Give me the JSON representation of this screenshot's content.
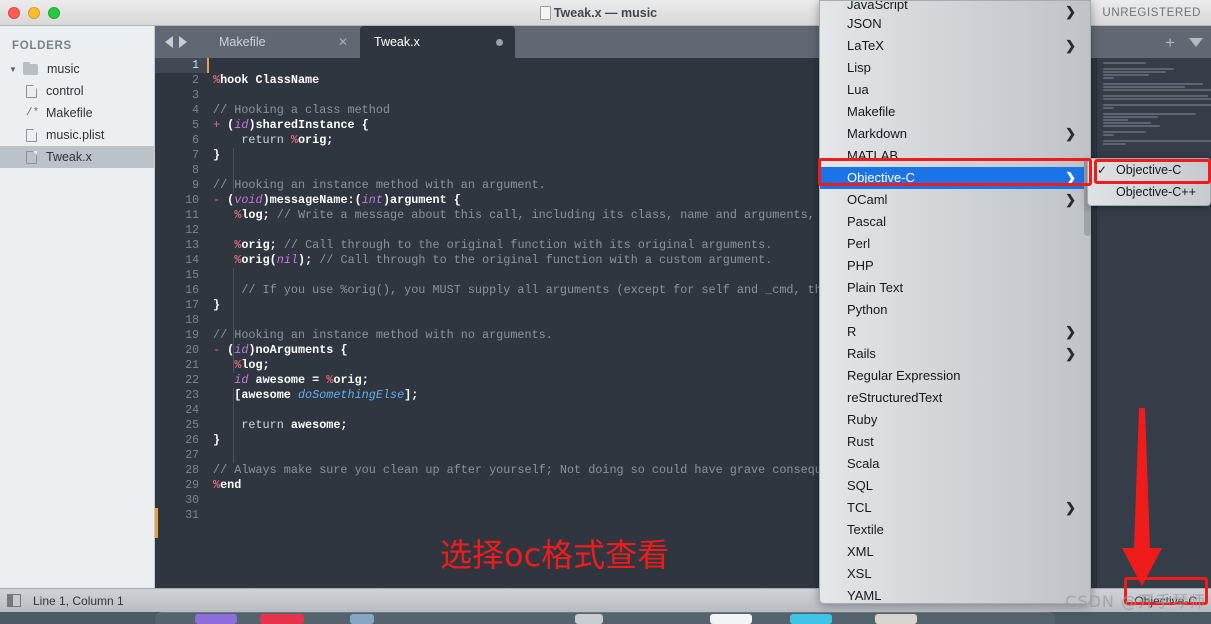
{
  "window": {
    "title": "Tweak.x — music",
    "unregistered_label": "UNREGISTERED",
    "traffic_lights": [
      "close-button",
      "minimize-button",
      "zoom-button"
    ]
  },
  "sidebar": {
    "header": "FOLDERS",
    "root": {
      "label": "music",
      "expanded_glyph": "▼"
    },
    "items": [
      {
        "label": "control",
        "icon": "file-icon",
        "selected": false
      },
      {
        "label": "Makefile",
        "icon": "makefile-icon",
        "selected": false
      },
      {
        "label": "music.plist",
        "icon": "file-icon",
        "selected": false
      },
      {
        "label": "Tweak.x",
        "icon": "file-icon",
        "selected": true
      }
    ]
  },
  "tabbar": {
    "nav_back": "◀",
    "nav_forward": "▶",
    "tabs": [
      {
        "label": "Makefile",
        "active": false,
        "close_glyph": "✕"
      },
      {
        "label": "Tweak.x",
        "active": true,
        "dirty_dot": true
      }
    ],
    "new_tab_glyph": "+",
    "tab_list_glyph": "▼"
  },
  "editor": {
    "annotation_cn": "选择oc格式查看",
    "lines": [
      {
        "n": 1,
        "current": true,
        "tokens": []
      },
      {
        "n": 2,
        "tokens": [
          {
            "t": "%",
            "c": "c-pct"
          },
          {
            "t": "hook ClassName",
            "c": "c-bold"
          }
        ]
      },
      {
        "n": 3,
        "tokens": []
      },
      {
        "n": 4,
        "tokens": [
          {
            "t": "// Hooking a class method",
            "c": "c-cmt"
          }
        ]
      },
      {
        "n": 5,
        "tokens": [
          {
            "t": "+ ",
            "c": "c-key"
          },
          {
            "t": "(",
            "c": "c-bold"
          },
          {
            "t": "id",
            "c": "c-type"
          },
          {
            "t": ")sharedInstance {",
            "c": "c-bold"
          }
        ]
      },
      {
        "n": 6,
        "tokens": [
          {
            "t": "    return ",
            "c": "c-plain"
          },
          {
            "t": "%",
            "c": "c-pct"
          },
          {
            "t": "orig;",
            "c": "c-bold"
          }
        ]
      },
      {
        "n": 7,
        "tokens": [
          {
            "t": "}",
            "c": "c-bold"
          }
        ]
      },
      {
        "n": 8,
        "tokens": []
      },
      {
        "n": 9,
        "tokens": [
          {
            "t": "// Hooking an instance method with an argument.",
            "c": "c-cmt"
          }
        ]
      },
      {
        "n": 10,
        "tokens": [
          {
            "t": "- ",
            "c": "c-key"
          },
          {
            "t": "(",
            "c": "c-bold"
          },
          {
            "t": "void",
            "c": "c-type"
          },
          {
            "t": ")messageName:(",
            "c": "c-bold"
          },
          {
            "t": "int",
            "c": "c-type"
          },
          {
            "t": ")argument {",
            "c": "c-bold"
          }
        ]
      },
      {
        "n": 11,
        "tokens": [
          {
            "t": "   ",
            "c": "c-plain"
          },
          {
            "t": "%",
            "c": "c-pct"
          },
          {
            "t": "log; ",
            "c": "c-bold"
          },
          {
            "t": "// Write a message about this call, including its class, name and arguments,",
            "c": "c-cmt"
          }
        ]
      },
      {
        "n": 12,
        "tokens": []
      },
      {
        "n": 13,
        "tokens": [
          {
            "t": "   ",
            "c": "c-plain"
          },
          {
            "t": "%",
            "c": "c-pct"
          },
          {
            "t": "orig; ",
            "c": "c-bold"
          },
          {
            "t": "// Call through to the original function with its original arguments.",
            "c": "c-cmt"
          }
        ]
      },
      {
        "n": 14,
        "tokens": [
          {
            "t": "   ",
            "c": "c-plain"
          },
          {
            "t": "%",
            "c": "c-pct"
          },
          {
            "t": "orig(",
            "c": "c-bold"
          },
          {
            "t": "nil",
            "c": "c-type"
          },
          {
            "t": "); ",
            "c": "c-bold"
          },
          {
            "t": "// Call through to the original function with a custom argument.",
            "c": "c-cmt"
          }
        ]
      },
      {
        "n": 15,
        "tokens": []
      },
      {
        "n": 16,
        "tokens": [
          {
            "t": "    // If you use %orig(), you MUST supply all arguments (except for self and _cmd, the",
            "c": "c-cmt"
          }
        ]
      },
      {
        "n": 17,
        "tokens": [
          {
            "t": "}",
            "c": "c-bold"
          }
        ]
      },
      {
        "n": 18,
        "tokens": []
      },
      {
        "n": 19,
        "tokens": [
          {
            "t": "// Hooking an instance method with no arguments.",
            "c": "c-cmt"
          }
        ]
      },
      {
        "n": 20,
        "tokens": [
          {
            "t": "- ",
            "c": "c-key"
          },
          {
            "t": "(",
            "c": "c-bold"
          },
          {
            "t": "id",
            "c": "c-type"
          },
          {
            "t": ")noArguments {",
            "c": "c-bold"
          }
        ]
      },
      {
        "n": 21,
        "tokens": [
          {
            "t": "   ",
            "c": "c-plain"
          },
          {
            "t": "%",
            "c": "c-pct"
          },
          {
            "t": "log;",
            "c": "c-bold"
          }
        ]
      },
      {
        "n": 22,
        "tokens": [
          {
            "t": "   ",
            "c": "c-plain"
          },
          {
            "t": "id",
            "c": "c-type"
          },
          {
            "t": " awesome = ",
            "c": "c-bold"
          },
          {
            "t": "%",
            "c": "c-pct"
          },
          {
            "t": "orig;",
            "c": "c-bold"
          }
        ]
      },
      {
        "n": 23,
        "tokens": [
          {
            "t": "   [awesome ",
            "c": "c-bold"
          },
          {
            "t": "doSomethingElse",
            "c": "c-sel"
          },
          {
            "t": "];",
            "c": "c-bold"
          }
        ]
      },
      {
        "n": 24,
        "tokens": []
      },
      {
        "n": 25,
        "tokens": [
          {
            "t": "    return ",
            "c": "c-plain"
          },
          {
            "t": "awesome;",
            "c": "c-bold"
          }
        ]
      },
      {
        "n": 26,
        "tokens": [
          {
            "t": "}",
            "c": "c-bold"
          }
        ]
      },
      {
        "n": 27,
        "tokens": []
      },
      {
        "n": 28,
        "tokens": [
          {
            "t": "// Always make sure you clean up after yourself; Not doing so could have grave conseque",
            "c": "c-cmt"
          }
        ]
      },
      {
        "n": 29,
        "tokens": [
          {
            "t": "%",
            "c": "c-pct"
          },
          {
            "t": "end",
            "c": "c-bold"
          }
        ]
      },
      {
        "n": 30,
        "tokens": []
      },
      {
        "n": 31,
        "tokens": []
      }
    ]
  },
  "menu": {
    "name": "syntax-language-menu",
    "items": [
      {
        "label": "JavaScript",
        "submenu": true,
        "clipped": true
      },
      {
        "label": "JSON",
        "submenu": false
      },
      {
        "label": "LaTeX",
        "submenu": true
      },
      {
        "label": "Lisp",
        "submenu": false
      },
      {
        "label": "Lua",
        "submenu": false
      },
      {
        "label": "Makefile",
        "submenu": false
      },
      {
        "label": "Markdown",
        "submenu": true
      },
      {
        "label": "MATLAB",
        "submenu": false
      },
      {
        "label": "Objective-C",
        "submenu": true,
        "highlighted": true
      },
      {
        "label": "OCaml",
        "submenu": true
      },
      {
        "label": "Pascal",
        "submenu": false
      },
      {
        "label": "Perl",
        "submenu": false
      },
      {
        "label": "PHP",
        "submenu": false
      },
      {
        "label": "Plain Text",
        "submenu": false
      },
      {
        "label": "Python",
        "submenu": false
      },
      {
        "label": "R",
        "submenu": true
      },
      {
        "label": "Rails",
        "submenu": true
      },
      {
        "label": "Regular Expression",
        "submenu": false
      },
      {
        "label": "reStructuredText",
        "submenu": false
      },
      {
        "label": "Ruby",
        "submenu": false
      },
      {
        "label": "Rust",
        "submenu": false
      },
      {
        "label": "Scala",
        "submenu": false
      },
      {
        "label": "SQL",
        "submenu": false
      },
      {
        "label": "TCL",
        "submenu": true
      },
      {
        "label": "Textile",
        "submenu": false
      },
      {
        "label": "XML",
        "submenu": false
      },
      {
        "label": "XSL",
        "submenu": false
      },
      {
        "label": "YAML",
        "submenu": false
      }
    ],
    "submenu_arrow_glyph": "❯"
  },
  "submenu": {
    "name": "objective-c-submenu",
    "check_glyph": "✓",
    "items": [
      {
        "label": "Objective-C",
        "checked": true
      },
      {
        "label": "Objective-C++",
        "checked": false
      }
    ]
  },
  "statusbar": {
    "sidebar_toggle": "sidebar-toggle-icon",
    "position": "Line 1, Column 1",
    "syntax": "Objective-C"
  },
  "watermark": "CSDN @开手琴师",
  "colors": {
    "accent_blue": "#1a74e8",
    "annotation_red": "#f01c1c",
    "editor_bg": "#2f3640",
    "tabbar_bg": "#5f6873",
    "sidebar_bg": "#eceff1"
  }
}
